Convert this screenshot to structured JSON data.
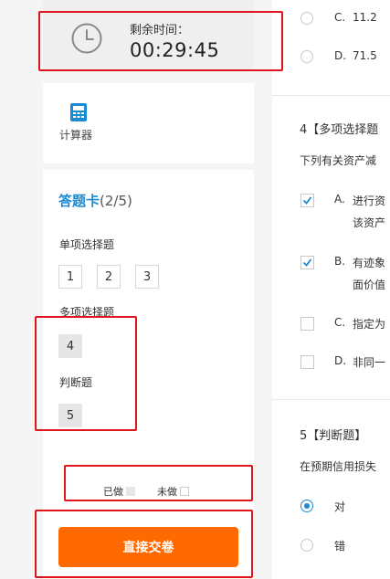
{
  "timer": {
    "label": "剩余时间：",
    "value": "00:29:45",
    "icon": "clock-icon"
  },
  "calculator": {
    "label": "计算器",
    "icon": "calculator-icon"
  },
  "answer_sheet": {
    "title": "答题卡",
    "count": "(2/5)",
    "sections": [
      {
        "label": "单项选择题",
        "questions": [
          "1",
          "2",
          "3"
        ]
      },
      {
        "label": "多项选择题",
        "questions": [
          "4"
        ]
      },
      {
        "label": "判断题",
        "questions": [
          "5"
        ]
      }
    ],
    "legend": {
      "done_label": "已做",
      "todo_label": "未做"
    },
    "submit_label": "直接交卷"
  },
  "question3_tail": {
    "options": [
      {
        "letter": "C.",
        "text": "11.2"
      },
      {
        "letter": "D.",
        "text": "71.5"
      }
    ]
  },
  "question4": {
    "title": "4【多项选择题",
    "desc": "下列有关资产减",
    "options": [
      {
        "letter": "A.",
        "line1": "进行资",
        "line2": "该资产",
        "checked": true
      },
      {
        "letter": "B.",
        "line1": "有迹象",
        "line2": "面价值",
        "checked": true
      },
      {
        "letter": "C.",
        "line1": "指定为",
        "checked": false
      },
      {
        "letter": "D.",
        "line1": "非同一",
        "checked": false
      }
    ]
  },
  "question5": {
    "title": "5【判断题】",
    "desc": "在预期信用损失",
    "options": [
      {
        "text": "对",
        "selected": true
      },
      {
        "text": "错",
        "selected": false
      }
    ]
  },
  "colors": {
    "accent": "#1a8ad4",
    "submit": "#ff6a00",
    "highlight": "#e0151b"
  }
}
